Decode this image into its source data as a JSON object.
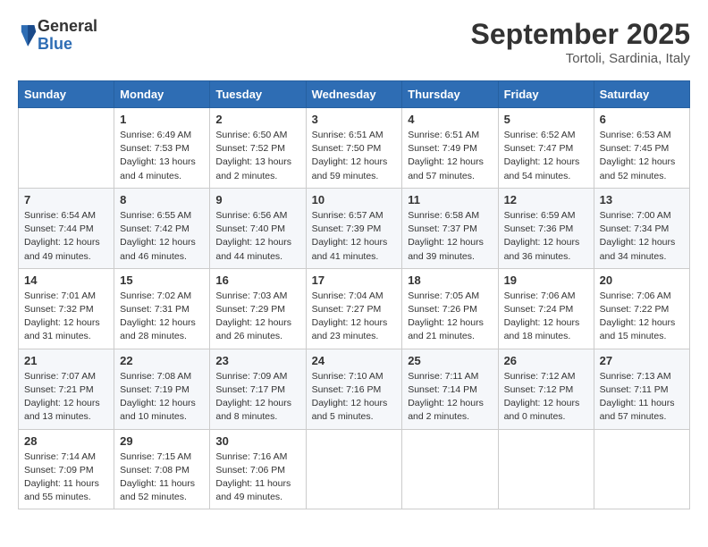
{
  "header": {
    "logo": {
      "general": "General",
      "blue": "Blue"
    },
    "title": "September 2025",
    "location": "Tortoli, Sardinia, Italy"
  },
  "calendar": {
    "columns": [
      "Sunday",
      "Monday",
      "Tuesday",
      "Wednesday",
      "Thursday",
      "Friday",
      "Saturday"
    ],
    "weeks": [
      [
        {
          "day": "",
          "info": ""
        },
        {
          "day": "1",
          "info": "Sunrise: 6:49 AM\nSunset: 7:53 PM\nDaylight: 13 hours\nand 4 minutes."
        },
        {
          "day": "2",
          "info": "Sunrise: 6:50 AM\nSunset: 7:52 PM\nDaylight: 13 hours\nand 2 minutes."
        },
        {
          "day": "3",
          "info": "Sunrise: 6:51 AM\nSunset: 7:50 PM\nDaylight: 12 hours\nand 59 minutes."
        },
        {
          "day": "4",
          "info": "Sunrise: 6:51 AM\nSunset: 7:49 PM\nDaylight: 12 hours\nand 57 minutes."
        },
        {
          "day": "5",
          "info": "Sunrise: 6:52 AM\nSunset: 7:47 PM\nDaylight: 12 hours\nand 54 minutes."
        },
        {
          "day": "6",
          "info": "Sunrise: 6:53 AM\nSunset: 7:45 PM\nDaylight: 12 hours\nand 52 minutes."
        }
      ],
      [
        {
          "day": "7",
          "info": "Sunrise: 6:54 AM\nSunset: 7:44 PM\nDaylight: 12 hours\nand 49 minutes."
        },
        {
          "day": "8",
          "info": "Sunrise: 6:55 AM\nSunset: 7:42 PM\nDaylight: 12 hours\nand 46 minutes."
        },
        {
          "day": "9",
          "info": "Sunrise: 6:56 AM\nSunset: 7:40 PM\nDaylight: 12 hours\nand 44 minutes."
        },
        {
          "day": "10",
          "info": "Sunrise: 6:57 AM\nSunset: 7:39 PM\nDaylight: 12 hours\nand 41 minutes."
        },
        {
          "day": "11",
          "info": "Sunrise: 6:58 AM\nSunset: 7:37 PM\nDaylight: 12 hours\nand 39 minutes."
        },
        {
          "day": "12",
          "info": "Sunrise: 6:59 AM\nSunset: 7:36 PM\nDaylight: 12 hours\nand 36 minutes."
        },
        {
          "day": "13",
          "info": "Sunrise: 7:00 AM\nSunset: 7:34 PM\nDaylight: 12 hours\nand 34 minutes."
        }
      ],
      [
        {
          "day": "14",
          "info": "Sunrise: 7:01 AM\nSunset: 7:32 PM\nDaylight: 12 hours\nand 31 minutes."
        },
        {
          "day": "15",
          "info": "Sunrise: 7:02 AM\nSunset: 7:31 PM\nDaylight: 12 hours\nand 28 minutes."
        },
        {
          "day": "16",
          "info": "Sunrise: 7:03 AM\nSunset: 7:29 PM\nDaylight: 12 hours\nand 26 minutes."
        },
        {
          "day": "17",
          "info": "Sunrise: 7:04 AM\nSunset: 7:27 PM\nDaylight: 12 hours\nand 23 minutes."
        },
        {
          "day": "18",
          "info": "Sunrise: 7:05 AM\nSunset: 7:26 PM\nDaylight: 12 hours\nand 21 minutes."
        },
        {
          "day": "19",
          "info": "Sunrise: 7:06 AM\nSunset: 7:24 PM\nDaylight: 12 hours\nand 18 minutes."
        },
        {
          "day": "20",
          "info": "Sunrise: 7:06 AM\nSunset: 7:22 PM\nDaylight: 12 hours\nand 15 minutes."
        }
      ],
      [
        {
          "day": "21",
          "info": "Sunrise: 7:07 AM\nSunset: 7:21 PM\nDaylight: 12 hours\nand 13 minutes."
        },
        {
          "day": "22",
          "info": "Sunrise: 7:08 AM\nSunset: 7:19 PM\nDaylight: 12 hours\nand 10 minutes."
        },
        {
          "day": "23",
          "info": "Sunrise: 7:09 AM\nSunset: 7:17 PM\nDaylight: 12 hours\nand 8 minutes."
        },
        {
          "day": "24",
          "info": "Sunrise: 7:10 AM\nSunset: 7:16 PM\nDaylight: 12 hours\nand 5 minutes."
        },
        {
          "day": "25",
          "info": "Sunrise: 7:11 AM\nSunset: 7:14 PM\nDaylight: 12 hours\nand 2 minutes."
        },
        {
          "day": "26",
          "info": "Sunrise: 7:12 AM\nSunset: 7:12 PM\nDaylight: 12 hours\nand 0 minutes."
        },
        {
          "day": "27",
          "info": "Sunrise: 7:13 AM\nSunset: 7:11 PM\nDaylight: 11 hours\nand 57 minutes."
        }
      ],
      [
        {
          "day": "28",
          "info": "Sunrise: 7:14 AM\nSunset: 7:09 PM\nDaylight: 11 hours\nand 55 minutes."
        },
        {
          "day": "29",
          "info": "Sunrise: 7:15 AM\nSunset: 7:08 PM\nDaylight: 11 hours\nand 52 minutes."
        },
        {
          "day": "30",
          "info": "Sunrise: 7:16 AM\nSunset: 7:06 PM\nDaylight: 11 hours\nand 49 minutes."
        },
        {
          "day": "",
          "info": ""
        },
        {
          "day": "",
          "info": ""
        },
        {
          "day": "",
          "info": ""
        },
        {
          "day": "",
          "info": ""
        }
      ]
    ]
  }
}
